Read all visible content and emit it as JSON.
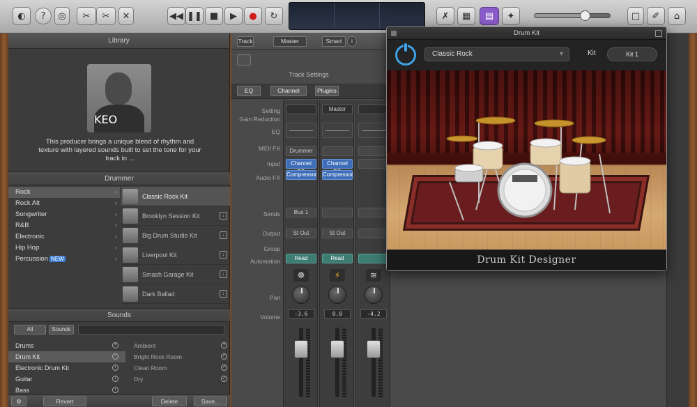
{
  "toolbar": {
    "lcd": [
      "",
      "",
      ""
    ],
    "volume_percent": 68
  },
  "library": {
    "title": "Library",
    "artist": {
      "name": "KEO",
      "description": "This producer brings a unique blend of rhythm and texture with layered sounds built to set the tone for your track in ..."
    },
    "categories_header": "Drummer",
    "categories": [
      {
        "label": "Rock",
        "selected": true
      },
      {
        "label": "Rock Alt"
      },
      {
        "label": "Songwriter"
      },
      {
        "label": "R&B"
      },
      {
        "label": "Electronic"
      },
      {
        "label": "Hip Hop"
      },
      {
        "label": "Percussion",
        "badge": "NEW"
      }
    ],
    "presets": [
      {
        "label": "Classic Rock Kit",
        "selected": true
      },
      {
        "label": "Brooklyn Session Kit"
      },
      {
        "label": "Big Drum Studio Kit"
      },
      {
        "label": "Liverpool Kit"
      },
      {
        "label": "Smash Garage Kit"
      },
      {
        "label": "Dark Ballad"
      }
    ],
    "sounds_header": "Sounds",
    "sounds_tabs": [
      "All",
      "Sounds"
    ],
    "sounds": [
      {
        "label": "Drums",
        "icon": "add"
      },
      {
        "label": "Drum Kit",
        "icon": "wave",
        "selected": true
      },
      {
        "label": "Electronic Drum Kit",
        "icon": "info"
      },
      {
        "label": "Guitar",
        "icon": "info"
      },
      {
        "label": "Bass",
        "icon": "info"
      }
    ],
    "sound_presets": [
      {
        "label": "Ambient",
        "icon": "add"
      },
      {
        "label": "Bright Rock Room",
        "icon": "check"
      },
      {
        "label": "Clean Room",
        "icon": "check"
      },
      {
        "label": "Dry",
        "icon": "check"
      }
    ],
    "bottom": {
      "left_label": "Revert",
      "mid_label": "Delete",
      "right_label": "Save..."
    }
  },
  "mixer": {
    "header_tabs": [
      "Track",
      "Master",
      "Smart"
    ],
    "caption": "Track Settings",
    "inspector_tabs": [
      "EQ",
      "Channel",
      "Plugins"
    ],
    "row_labels": [
      "Setting",
      "Gain Reduction",
      "EQ",
      "MIDI FX",
      "Input",
      "Audio FX",
      "Sends",
      "Output",
      "Group",
      "Automation",
      "Pan",
      "Volume"
    ],
    "strips": [
      {
        "name": "",
        "input": "Drummer",
        "fx": [
          "Channel EQ",
          "Compressor"
        ],
        "send": "Bus 1",
        "output": "St Out",
        "automation": "Read",
        "icon": "dance",
        "value": "-3.6"
      },
      {
        "name": "Master",
        "input": "",
        "fx": [
          "Channel EQ",
          "Compressor"
        ],
        "send": "",
        "output": "St Out",
        "automation": "Read",
        "icon": "bolt",
        "value": "0.0"
      },
      {
        "name": "",
        "input": "",
        "fx": [],
        "send": "",
        "output": "",
        "automation": "",
        "icon": "wave",
        "value": "-4.2"
      }
    ]
  },
  "plugin": {
    "title": "Drum Kit",
    "preset": "Classic Rock",
    "side_label": "Kit",
    "side_value": "Kit 1",
    "footer": "Drum Kit Designer"
  }
}
